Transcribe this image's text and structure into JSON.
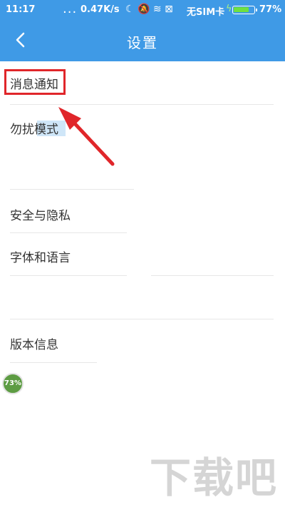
{
  "status_bar": {
    "time": "11:17",
    "dots": "...",
    "speed": "0.47K/s",
    "icons": "☾ 🔕 ≋ ⊠",
    "sim": "无SIM卡",
    "battery_percent": "77%",
    "battery_level": 0.77
  },
  "header": {
    "back_icon": "chevron-left-icon",
    "title": "设置"
  },
  "settings": {
    "items": [
      {
        "label": "消息通知"
      },
      {
        "label": "勿扰模式"
      },
      {
        "label": "安全与隐私"
      },
      {
        "label": "字体和语言"
      },
      {
        "label": "版本信息"
      }
    ]
  },
  "badge": {
    "text": "73%"
  },
  "watermark": {
    "text": "下载吧"
  },
  "colors": {
    "header_bg": "#3f9ae6",
    "annotation_red": "#e0262a",
    "battery_green": "#6fe040"
  }
}
